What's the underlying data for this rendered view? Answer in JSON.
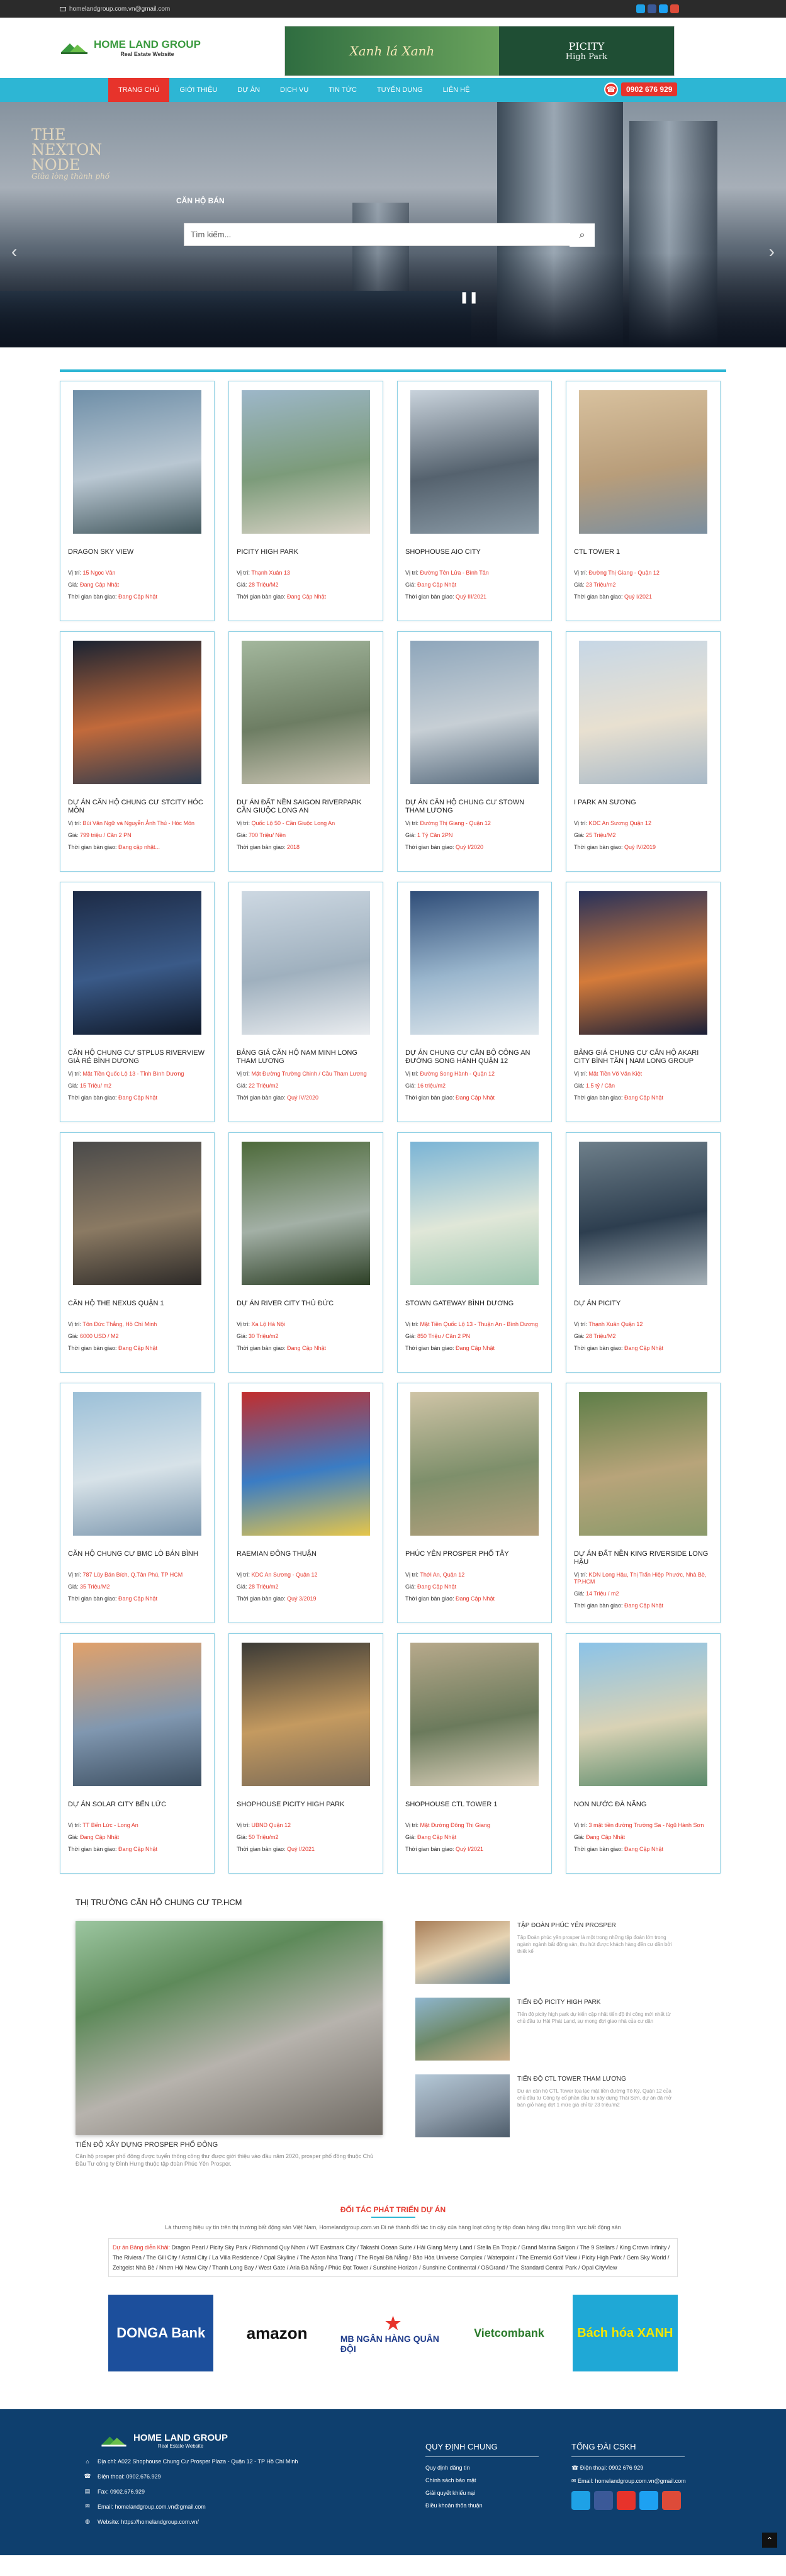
{
  "topbar": {
    "email": "homelandgroup.com.vn@gmail.com"
  },
  "logo": {
    "name": "HOME LAND GROUP",
    "tagline": "Real Estate Website"
  },
  "ad_banner": {
    "left": "Xanh lá Xanh",
    "right_title": "PICITY",
    "right_sub": "High Park"
  },
  "nav": {
    "items": [
      "TRANG CHỦ",
      "GIỚI THIỆU",
      "DỰ ÁN",
      "DỊCH VỤ",
      "TIN TỨC",
      "TUYỂN DỤNG",
      "LIÊN HỆ"
    ],
    "hotline": "0902 676 929"
  },
  "hero": {
    "brand_line1": "THE",
    "brand_line2": "NEXTON",
    "brand_line3": "NODE",
    "brand_sub": "Giữa lòng thành phố",
    "category": "CĂN HỘ BÁN",
    "search_placeholder": "Tìm kiếm..."
  },
  "labels": {
    "location": "Vị trí:",
    "price": "Giá:",
    "handover": "Thời gian bàn giao:"
  },
  "projects": [
    {
      "title": "DRAGON SKY VIEW",
      "location": "15 Ngọc Vân",
      "price": "Đang Cập Nhật",
      "handover": "Đang Cập Nhật"
    },
    {
      "title": "PICITY HIGH PARK",
      "location": "Thạnh Xuân 13",
      "price": "28 Triệu/M2",
      "handover": "Đang Cập Nhật"
    },
    {
      "title": "SHOPHOUSE AIO CITY",
      "location": "Đường Tên Lửa - Bình Tân",
      "price": "Đang Cập Nhật",
      "handover": "Quý III/2021"
    },
    {
      "title": "CTL TOWER 1",
      "location": "Đường Thị Giang - Quận 12",
      "price": "23 Triệu/m2",
      "handover": "Quý I/2021"
    },
    {
      "title": "DỰ ÁN CĂN HỘ CHUNG CƯ STCITY HÓC MÔN",
      "location": "Bùi Văn Ngữ và Nguyễn Ảnh Thủ - Hóc Môn",
      "price": "799 triệu / Căn 2 PN",
      "handover": "Đang cập nhật..."
    },
    {
      "title": "DỰ ÁN ĐẤT NỀN SAIGON RIVERPARK CẦN GIUỘC LONG AN",
      "location": "Quốc Lộ 50 - Cần Giuộc Long An",
      "price": "700 Triệu/ Nền",
      "handover": "2018"
    },
    {
      "title": "DỰ ÁN CĂN HỘ CHUNG CƯ STOWN THAM LƯƠNG",
      "location": "Đường Thị Giang - Quận 12",
      "price": "1 Tỷ Căn 2PN",
      "handover": "Quý I/2020"
    },
    {
      "title": "I PARK AN SƯƠNG",
      "location": "KDC An Sương Quận 12",
      "price": "25 Triệu/M2",
      "handover": "Quý IV/2019"
    },
    {
      "title": "CĂN HỘ CHUNG CƯ STPLUS RIVERVIEW GIÁ RẺ BÌNH DƯƠNG",
      "location": "Mặt Tiền Quốc Lộ 13 - Tỉnh Bình Dương",
      "price": "15 Triệu/ m2",
      "handover": "Đang Cập Nhật"
    },
    {
      "title": "BẢNG GIÁ CĂN HỘ NAM MINH LONG THAM LƯƠNG",
      "location": "Mặt Đường Trường Chinh / Cầu Tham Lương",
      "price": "22 Triệu/m2",
      "handover": "Quý IV/2020"
    },
    {
      "title": "DỰ ÁN CHUNG CƯ CĂN BỘ CÔNG AN ĐƯỜNG SONG HÀNH QUẬN 12",
      "location": "Đường Song Hành - Quận 12",
      "price": "16 triệu/m2",
      "handover": "Đang Cập Nhật"
    },
    {
      "title": "BẢNG GIÁ CHUNG CƯ CĂN HỘ AKARI CITY BÌNH TÂN | NAM LONG GROUP",
      "location": "Mặt Tiền Võ Văn Kiệt",
      "price": "1.5 tỷ / Căn",
      "handover": "Đang Cập Nhật"
    },
    {
      "title": "CĂN HỘ THE NEXUS QUẬN 1",
      "location": "Tôn Đức Thắng, Hồ Chí Minh",
      "price": "6000 USD / M2",
      "handover": "Đang Cập Nhật"
    },
    {
      "title": "DỰ ÁN RIVER CITY THỦ ĐỨC",
      "location": "Xa Lộ Hà Nội",
      "price": "30 Triệu/m2",
      "handover": "Đang Cập Nhật"
    },
    {
      "title": "STOWN GATEWAY BÌNH DƯƠNG",
      "location": "Mặt Tiền Quốc Lộ 13 - Thuận An - Bình Dương",
      "price": "850 Triệu / Căn 2 PN",
      "handover": "Đang Cập Nhật"
    },
    {
      "title": "DỰ ÁN PICITY",
      "location": "Thạnh Xuân Quận 12",
      "price": "28 Triệu/M2",
      "handover": "Đang Cập Nhật"
    },
    {
      "title": "CĂN HỘ CHUNG CƯ BMC LÒ BÁN BÌNH",
      "location": "787 Lũy Bán Bích, Q.Tân Phú, TP HCM",
      "price": "35 Triệu/M2",
      "handover": "Đang Cập Nhật"
    },
    {
      "title": "RAEMIAN ĐÔNG THUẬN",
      "location": "KDC An Sương - Quận 12",
      "price": "28 Triệu/m2",
      "handover": "Quý 3/2019"
    },
    {
      "title": "PHÚC YÊN PROSPER PHỐ TÂY",
      "location": "Thới An, Quận 12",
      "price": "Đang Cập Nhật",
      "handover": "Đang Cập Nhật"
    },
    {
      "title": "DỰ ÁN ĐẤT NỀN KING RIVERSIDE LONG HẬU",
      "location": "KDN Long Hậu, Thị Trấn Hiệp Phước, Nhà Bè, TP.HCM",
      "price": "14 Triệu / m2",
      "handover": "Đang Cập Nhật"
    },
    {
      "title": "DỰ ÁN SOLAR CITY BẾN LỨC",
      "location": "TT Bến Lức - Long An",
      "price": "Đang Cập Nhật",
      "handover": "Đang Cập Nhật"
    },
    {
      "title": "SHOPHOUSE PICITY HIGH PARK",
      "location": "UBND Quận 12",
      "price": "50 Triệu/m2",
      "handover": "Quý I/2021"
    },
    {
      "title": "SHOPHOUSE CTL TOWER 1",
      "location": "Mặt Đường Đông Thị Giang",
      "price": "Đang Cập Nhật",
      "handover": "Quý I/2021"
    },
    {
      "title": "NON NƯỚC ĐÀ NẴNG",
      "location": "3 mặt tiền đường Trường Sa - Ngũ Hành Sơn",
      "price": "Đang Cập Nhật",
      "handover": "Đang Cập Nhật"
    }
  ],
  "news": {
    "section_title": "THỊ TRƯỜNG CĂN HỘ CHUNG CƯ TP.HCM",
    "feature": {
      "title": "TIẾN ĐỘ XÂY DỰNG PROSPER PHỐ ĐÔNG",
      "desc": "Căn hộ prosper phố đông được tuyển thông công thư được giới thiệu vào đầu năm 2020, prosper phố đông thuộc Chủ Đầu Tư công ty Đình Hưng thuộc tập đoàn Phúc Yên Prosper."
    },
    "items": [
      {
        "title": "TẬP ĐOÀN PHÚC YÊN PROSPER",
        "desc": "Tập Đoàn phúc yên prosper là một trong những tập đoàn lớn trong ngành ngành bất động sản, thu hút được khách hàng đến cư dân bởi thiết kế"
      },
      {
        "title": "TIẾN ĐỘ PICITY HIGH PARK",
        "desc": "Tiến độ picity high park dự kiến cập nhật tiến độ thi công mới nhất từ chủ đầu tư Hải Phát Land, sự mong đợi giao nhà của cư dân"
      },
      {
        "title": "TIẾN ĐỘ CTL TOWER THAM LƯƠNG",
        "desc": "Dự án căn hộ CTL Tower tọa lạc mặt tiền đường Tô Ký, Quận 12 của chủ đầu tư Công ty cổ phần đầu tư xây dựng Thái Sơn, dự án đã mở bán giỏ hàng đợt 1 mức giá chỉ từ 23 triệu/m2"
      }
    ]
  },
  "partners": {
    "title": "ĐỐI TÁC PHÁT TRIỂN DỰ ÁN",
    "desc": "Là thương hiệu uy tín trên thị trường bất động sản Việt Nam, Homelandgroup.com.vn Đi nè thành đối tác tin cậy của hàng loạt công ty tập đoàn hàng đầu trong lĩnh vực bất động sản",
    "projects_label": "Dự án Bảng diễn Khải:",
    "projects_text": "Dragon Pearl / Picity Sky Park / Richmond Quy Nhơn / WT Eastmark City / Takashi Ocean Suite / Hải Giang Merry Land / Stella En Tropic / Grand Marina Saigon / The 9 Stellars / King Crown Infinity / The Riviera / The Gill City / Astral City / La Villa Residence / Opal Skyline / The Aston Nha Trang / The Royal Đà Nẵng / Bảo Hòa Universe Complex / Waterpoint / The Emerald Golf View / Picity High Park / Gem Sky World / Zeitgeist Nhà Bè / Nhơn Hội New City / Thanh Long Bay / West Gate / Aria Đà Nẵng / Phúc Đạt Tower / Sunshine Horizon / Sunshine Continental / OSGrand / The Standard Central Park / Opal CityView",
    "logos": [
      {
        "name": "DONGA Bank",
        "bg": "#1c4f9c"
      },
      {
        "name": "amazon",
        "bg": "#ffffff"
      },
      {
        "name": "MB NGÂN HÀNG QUÂN ĐỘI",
        "bg": "#ffffff"
      },
      {
        "name": "Vietcombank",
        "bg": "#ffffff"
      },
      {
        "name": "Bách hóa XANH",
        "bg": "#1fa8d6"
      }
    ]
  },
  "footer": {
    "logo_name": "HOME LAND GROUP",
    "logo_tag": "Real Estate Website",
    "address": "Địa chỉ: A022 Shophouse Chung Cư Prosper Plaza - Quận 12 - TP Hồ Chí Minh",
    "hotline": "Điện thoại: 0902.676.929",
    "fax": "Fax: 0902.676.929",
    "email": "Email: homelandgroup.com.vn@gmail.com",
    "website": "Website: https://homelandgroup.com.vn/",
    "col2_title": "QUY ĐỊNH CHUNG",
    "col2_items": [
      "Quy định đăng tin",
      "Chính sách bảo mật",
      "Giải quyết khiếu nại",
      "Điều khoản thỏa thuận"
    ],
    "col3_title": "TỔNG ĐÀI CSKH",
    "col3_phone": "Điện thoại: 0902 676 929",
    "col3_email": "Email: homelandgroup.com.vn@gmail.com"
  },
  "colors": {
    "accent": "#2db6d4",
    "red": "#e7332b",
    "footer": "#0e3f6e"
  }
}
